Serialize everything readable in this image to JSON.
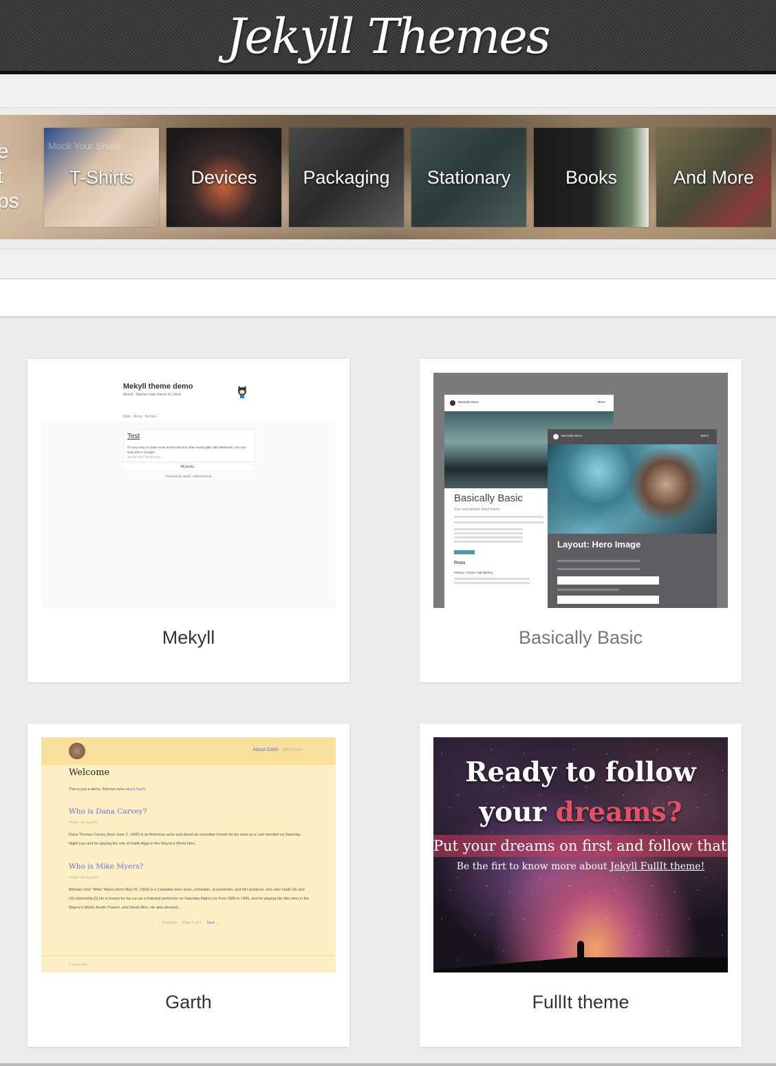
{
  "header": {
    "title": "Jekyll Themes"
  },
  "banner": {
    "partial_text": [
      "e",
      "t",
      "ps"
    ],
    "tiles": [
      {
        "label": "T-Shirts",
        "sub": "Mock Your Shots",
        "color": "#c9b49a"
      },
      {
        "label": "Devices",
        "color": "#2b2b2b"
      },
      {
        "label": "Packaging",
        "color": "#3a3a3a"
      },
      {
        "label": "Stationary",
        "color": "#3a4a48"
      },
      {
        "label": "Books",
        "color": "#1e1e1e"
      },
      {
        "label": "And More",
        "color": "#4a4a3a"
      }
    ]
  },
  "themes": [
    {
      "name": "Mekyll",
      "preview": {
        "site_title": "Mekyll theme demo",
        "tagline": "Mekyll - Medium style theme for Jekyll",
        "nav": [
          "Main",
          "About",
          "Archive"
        ],
        "post_title": "Test",
        "post_excerpt": "It's very easy to make some words bold and other words italic with Markdown. You can even link to Google!",
        "post_meta": "Jan 10 2017   Read more...",
        "all_posts": "All posts...",
        "powered": "Powered by Jekyll - Mekyll theme"
      }
    },
    {
      "name": "Basically Basic",
      "preview": {
        "brand": "Basically Basic",
        "menu": "Menu",
        "title": "Basically Basic",
        "subtitle": "Your new default Jekyll theme",
        "section": "Posts",
        "post_title": "Markup: Syntax Highlighting",
        "hero_title": "Layout: Hero Image"
      }
    },
    {
      "name": "Garth",
      "preview": {
        "nav_active": "About Garth",
        "nav_other": "Welcome",
        "heading": "Welcome",
        "intro": "This is just a demo, find out more",
        "intro_link": "about Garth",
        "post1_title": "Who is Dana Carvey?",
        "post1_meta": "People · 26 Aug 2014",
        "post1_excerpt": "Dana Thomas Carvey (born June 2, 1955) is an American actor and stand-up comedian known for his work as a cast member on Saturday Night Live and for playing the role of Garth Algar in the Wayne's World films.",
        "post2_title": "Who is Mike Myers?",
        "post2_meta": "People · 26 Aug 2014",
        "post2_excerpt": "Michael John \"Mike\" Myers (born May 25, 1963) is a Canadian-born actor, comedian, screenwriter, and film producer, who also holds UK and US citizenship.[1] He is known for his run as a featured performer on Saturday Night Live from 1989 to 1995, and for playing the title roles in the Wayne's World, Austin Powers, and Shrek films. He also directed...",
        "prev": "← Previous",
        "page": "Page 1 of 2",
        "next": "Next →",
        "copyright": "© Garth 2017"
      }
    },
    {
      "name": "FullIt theme",
      "preview": {
        "line1": "Ready to follow",
        "line2a": "your",
        "line2b": "dreams?",
        "line3": "Put your dreams on first and follow that!",
        "line4a": "Be the firt to know more about",
        "line4b": "Jekyll FullIt theme!"
      }
    }
  ],
  "colors": {
    "header_bg": "#3a3a3a",
    "page_bg": "#ececec",
    "link": "#6f6fd8",
    "accent_pink": "#e05268"
  }
}
